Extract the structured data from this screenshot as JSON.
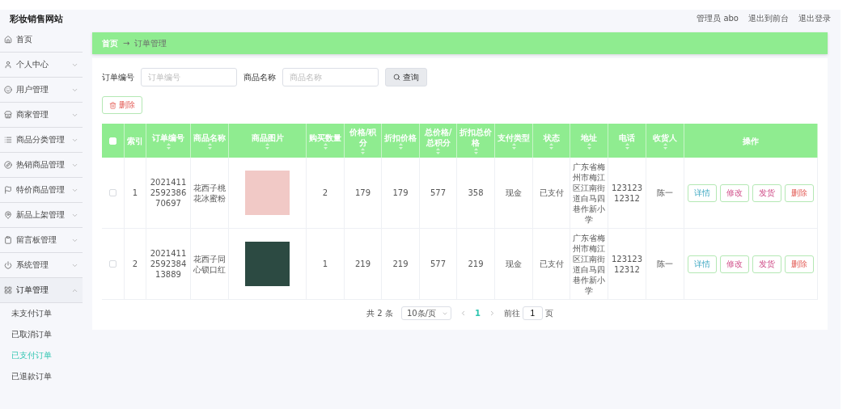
{
  "header": {
    "title": "彩妆销售网站",
    "links": [
      "管理员 abo",
      "退出到前台",
      "退出登录"
    ]
  },
  "sidebar": {
    "items": [
      {
        "label": "首页",
        "expandable": false,
        "expanded": false
      },
      {
        "label": "个人中心",
        "expandable": true,
        "expanded": false
      },
      {
        "label": "用户管理",
        "expandable": true,
        "expanded": false
      },
      {
        "label": "商家管理",
        "expandable": true,
        "expanded": false
      },
      {
        "label": "商品分类管理",
        "expandable": true,
        "expanded": false
      },
      {
        "label": "热销商品管理",
        "expandable": true,
        "expanded": false
      },
      {
        "label": "特价商品管理",
        "expandable": true,
        "expanded": false
      },
      {
        "label": "新品上架管理",
        "expandable": true,
        "expanded": false
      },
      {
        "label": "留言板管理",
        "expandable": true,
        "expanded": false
      },
      {
        "label": "系统管理",
        "expandable": true,
        "expanded": false
      },
      {
        "label": "订单管理",
        "expandable": true,
        "expanded": true,
        "children": [
          {
            "label": "未支付订单",
            "selected": false
          },
          {
            "label": "已取消订单",
            "selected": false
          },
          {
            "label": "已支付订单",
            "selected": true
          },
          {
            "label": "已退款订单",
            "selected": false
          }
        ]
      }
    ]
  },
  "breadcrumb": {
    "items": [
      "首页",
      "订单管理"
    ],
    "separator": "→"
  },
  "search": {
    "fields": [
      {
        "label": "订单编号",
        "placeholder": "订单编号"
      },
      {
        "label": "商品名称",
        "placeholder": "商品名称"
      }
    ],
    "button": "查询"
  },
  "delete_button": "删除",
  "table": {
    "select_all": false,
    "columns": [
      {
        "label": "索引",
        "sortable": false
      },
      {
        "label": "订单编号",
        "sortable": true
      },
      {
        "label": "商品名称",
        "sortable": true
      },
      {
        "label": "商品图片",
        "sortable": true
      },
      {
        "label": "购买数量",
        "sortable": true
      },
      {
        "label": "价格/积分",
        "sortable": true
      },
      {
        "label": "折扣价格",
        "sortable": true
      },
      {
        "label": "总价格/总积分",
        "sortable": true
      },
      {
        "label": "折扣总价格",
        "sortable": true
      },
      {
        "label": "支付类型",
        "sortable": true
      },
      {
        "label": "状态",
        "sortable": true
      },
      {
        "label": "地址",
        "sortable": true
      },
      {
        "label": "电话",
        "sortable": true
      },
      {
        "label": "收货人",
        "sortable": true
      },
      {
        "label": "操作",
        "sortable": false
      }
    ],
    "rows": [
      {
        "checked": false,
        "cells": [
          "1",
          "2021411259238670697",
          "花西子桃花冰蜜粉",
          "",
          "2",
          "179",
          "179",
          "577",
          "358",
          "现金",
          "已支付",
          "广东省梅州市梅江区江南街道白马四巷作新小学",
          "12312312312",
          "陈一"
        ],
        "actions": [
          "详情",
          "修改",
          "发货",
          "删除"
        ]
      },
      {
        "checked": false,
        "cells": [
          "2",
          "2021411259238413889",
          "花西子同心锁口红",
          "",
          "1",
          "219",
          "219",
          "577",
          "219",
          "现金",
          "已支付",
          "广东省梅州市梅江区江南街道白马四巷作新小学",
          "12312312312",
          "陈一"
        ],
        "actions": [
          "详情",
          "修改",
          "发货",
          "删除"
        ]
      }
    ]
  },
  "pagination": {
    "total": "共 2 条",
    "page_size": "10条/页",
    "pages": [
      {
        "label": "1",
        "selected": true
      }
    ],
    "goto_label": "前往",
    "goto_value": "1",
    "goto_suffix": "页"
  }
}
